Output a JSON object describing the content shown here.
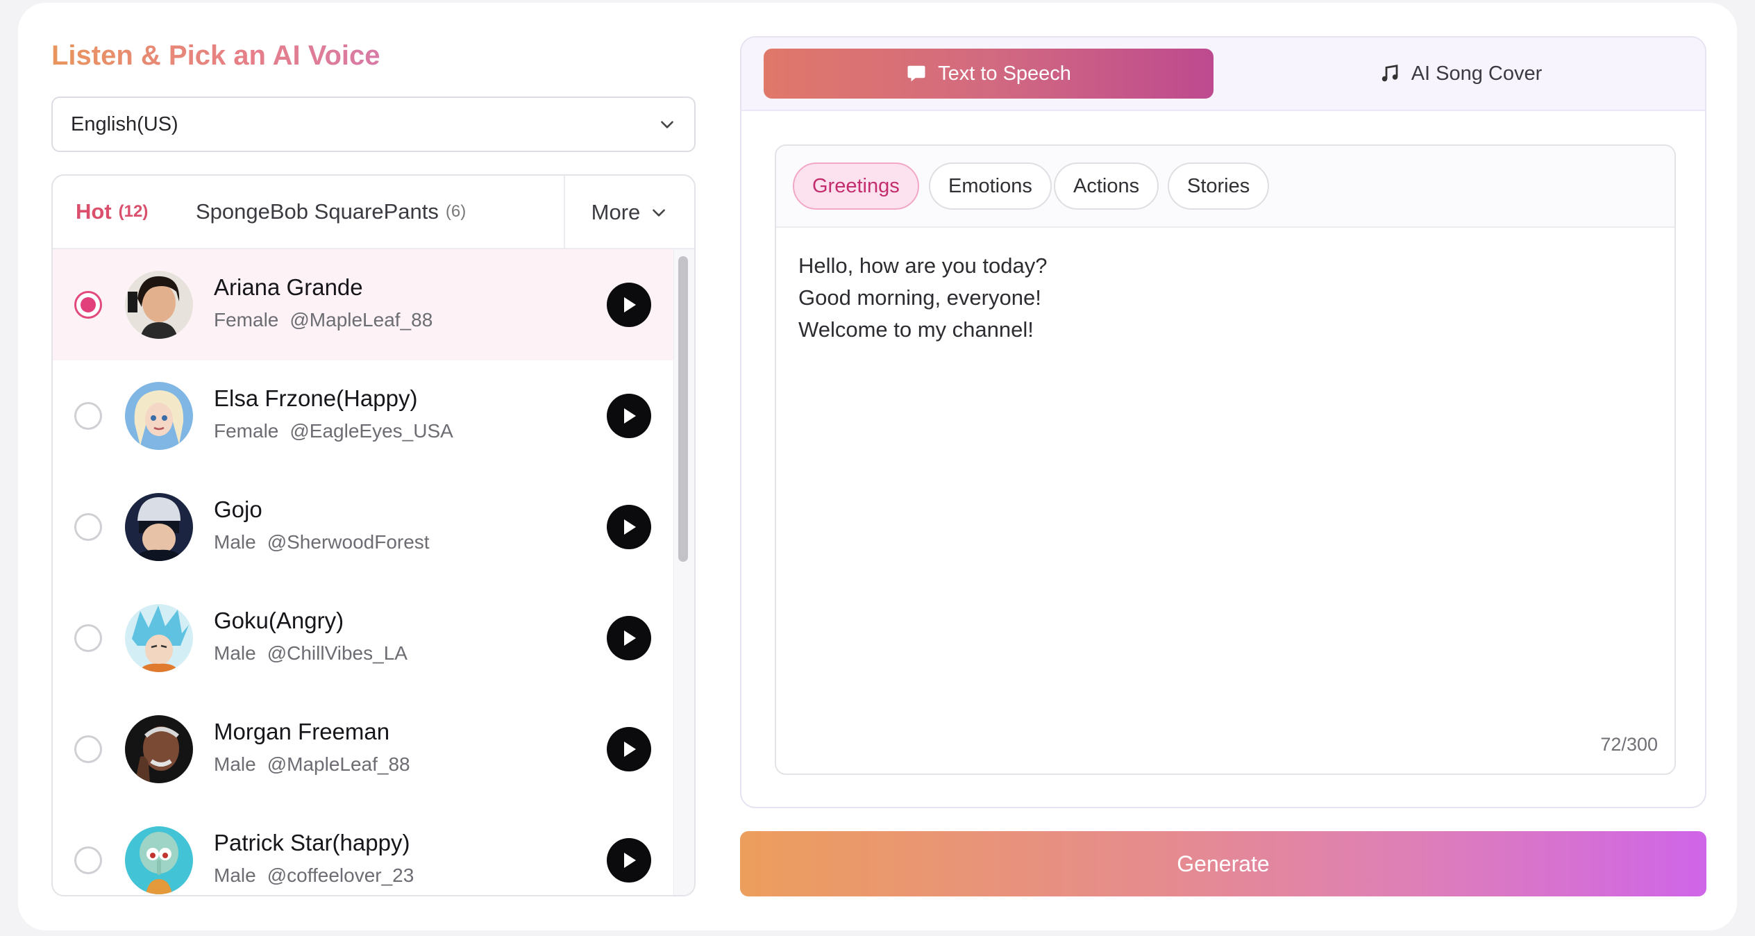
{
  "title": "Listen & Pick an AI Voice",
  "language_select": {
    "value": "English(US)"
  },
  "voice_tabs": [
    {
      "label": "Hot",
      "count": "(12)"
    },
    {
      "label": "SpongeBob SquarePants",
      "count": "(6)"
    }
  ],
  "more_label": "More",
  "voices": [
    {
      "name": "Ariana Grande",
      "gender": "Female",
      "handle": "@MapleLeaf_88",
      "selected": true
    },
    {
      "name": "Elsa Frzone(Happy)",
      "gender": "Female",
      "handle": "@EagleEyes_USA",
      "selected": false
    },
    {
      "name": "Gojo",
      "gender": "Male",
      "handle": "@SherwoodForest",
      "selected": false
    },
    {
      "name": "Goku(Angry)",
      "gender": "Male",
      "handle": "@ChillVibes_LA",
      "selected": false
    },
    {
      "name": "Morgan Freeman",
      "gender": "Male",
      "handle": "@MapleLeaf_88",
      "selected": false
    },
    {
      "name": "Patrick Star(happy)",
      "gender": "Male",
      "handle": "@coffeelover_23",
      "selected": false
    }
  ],
  "mode_tabs": [
    {
      "label": "Text to Speech",
      "icon": "speech-bubble-icon",
      "active": true
    },
    {
      "label": "AI Song Cover",
      "icon": "music-note-icon",
      "active": false
    }
  ],
  "chips": [
    {
      "label": "Greetings",
      "active": true
    },
    {
      "label": "Emotions",
      "active": false
    },
    {
      "label": "Actions",
      "active": false
    },
    {
      "label": "Stories",
      "active": false
    }
  ],
  "text_input": {
    "value": "Hello, how are you today?\nGood morning, everyone!\nWelcome to my channel!"
  },
  "char_counter": "72/300",
  "generate_label": "Generate",
  "colors": {
    "accent": "#e2407a",
    "gradient_start": "#ec9e5c",
    "gradient_end": "#cf65e8"
  }
}
